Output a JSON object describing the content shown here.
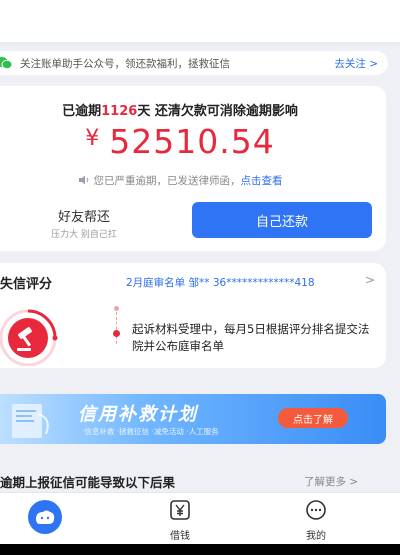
{
  "notice": {
    "text": "关注账单助手公众号，领还款福利，拯救征信",
    "link": "去关注 >"
  },
  "overdue": {
    "prefix": "已逾期",
    "days": "1126",
    "suffix": "天 还清欠款可消除逾期影响"
  },
  "amount": {
    "currency": "¥",
    "value": "52510.54"
  },
  "warning": {
    "text": "您已严重逾期，已发送律师函，",
    "link": "点击查看"
  },
  "actions": {
    "friend_title": "好友帮还",
    "friend_sub": "压力大 别自己扛",
    "self_label": "自己还款"
  },
  "credit": {
    "title": "失信评分",
    "info": "2月庭审名单 邹** 36*************418",
    "chevron": ">",
    "message": "起诉材料受理中，每月5日根据评分排名提交法院并公布庭审名单"
  },
  "banner": {
    "title": "信用补救计划",
    "subtitle": "·信息补救 ·拯救征信 ·减免活动 ·人工服务",
    "button": "点击了解"
  },
  "consequences": {
    "title": "逾期上报征信可能导致以下后果",
    "more": "了解更多 >"
  },
  "tabs": {
    "borrow": "借钱",
    "me": "我的"
  },
  "colors": {
    "accent_blue": "#2f74f5",
    "alert_red": "#e8283c"
  }
}
